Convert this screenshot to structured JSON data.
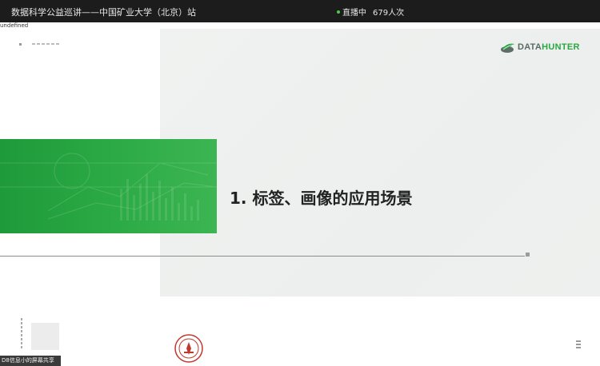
{
  "topbar": {
    "title": "数据科学公益巡讲——中国矿业大学（北京）站",
    "live_status": "直播中",
    "viewer_count": "679人次",
    "live_dot_color": "#3fd14a"
  },
  "overlay_text": "undefined",
  "slide": {
    "brand_logo": {
      "part1": "DATA",
      "part2": "HUNTER",
      "icon": "datahunter-leaf-logo"
    },
    "heading": "1. 标签、画像的应用场景",
    "accent_color": "#29a843",
    "emblem": "university-emblem"
  },
  "share_status": "D8信息小的屏幕共享"
}
